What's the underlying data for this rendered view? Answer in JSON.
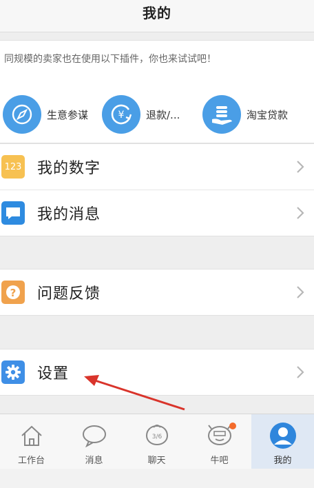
{
  "header": {
    "title": "我的"
  },
  "plugins": {
    "hint": "同规模的卖家也在使用以下插件，你也来试试吧！",
    "items": [
      {
        "label": "生意参谋",
        "icon": "compass-icon"
      },
      {
        "label": "退款/...",
        "icon": "refund-yen-icon"
      },
      {
        "label": "淘宝贷款",
        "icon": "hand-coins-icon"
      }
    ]
  },
  "menu": {
    "my_number": "我的数字",
    "my_messages": "我的消息",
    "feedback": "问题反馈",
    "settings": "设置",
    "number_badge": "123"
  },
  "tabbar": {
    "items": [
      {
        "label": "工作台",
        "icon": "home-icon"
      },
      {
        "label": "消息",
        "icon": "chat-bubble-icon"
      },
      {
        "label": "聊天",
        "icon": "chat-icon",
        "badge": "3/6"
      },
      {
        "label": "牛吧",
        "icon": "cow-icon",
        "dot": true
      },
      {
        "label": "我的",
        "icon": "user-icon",
        "active": true
      }
    ]
  },
  "colors": {
    "accent": "#4a9ee6",
    "number_icon": "#f7c152",
    "feedback_icon": "#f0a24d",
    "settings_icon": "#3f8fe6",
    "messages_icon": "#2e8be0",
    "annotation_arrow": "#d9342b",
    "notification_dot": "#f36b2b"
  }
}
